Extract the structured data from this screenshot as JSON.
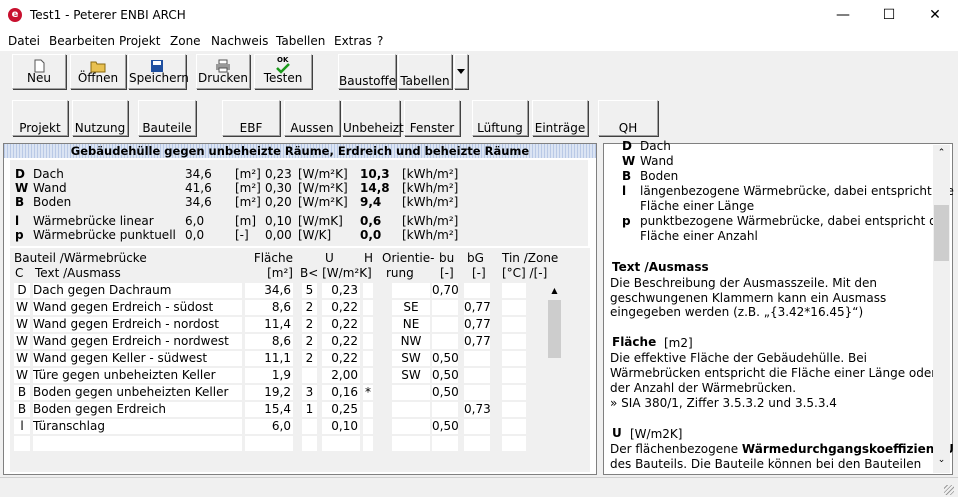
{
  "window": {
    "title": "Test1 - Peterer ENBI ARCH",
    "app_icon": "e"
  },
  "menu": [
    "Datei",
    "Bearbeiten",
    "Projekt",
    "Zone",
    "Nachweis",
    "Tabellen",
    "Extras",
    "?"
  ],
  "toolbar": [
    "Neu",
    "Öffnen",
    "Speichern",
    "Drucken",
    "Testen",
    "Baustoffe",
    "Tabellen"
  ],
  "testen_badge": "OK",
  "nav": [
    "Projekt",
    "Nutzung",
    "Bauteile",
    "EBF",
    "Aussen",
    "Unbeheizt",
    "Fenster",
    "Lüftung",
    "Einträge",
    "QH"
  ],
  "panel_title": "Gebäudehülle gegen unbeheizte Räume, Erdreich und beheizte Räume",
  "summary": [
    {
      "code": "D",
      "name": "Dach",
      "area": "34,6",
      "area_unit": "[m²]",
      "u": "0,23",
      "u_unit": "[W/m²K]",
      "q": "10,3",
      "q_unit": "[kWh/m²]"
    },
    {
      "code": "W",
      "name": "Wand",
      "area": "41,6",
      "area_unit": "[m²]",
      "u": "0,30",
      "u_unit": "[W/m²K]",
      "q": "14,8",
      "q_unit": "[kWh/m²]"
    },
    {
      "code": "B",
      "name": "Boden",
      "area": "34,6",
      "area_unit": "[m²]",
      "u": "0,20",
      "u_unit": "[W/m²K]",
      "q": "9,4",
      "q_unit": "[kWh/m²]"
    },
    {
      "code": "l",
      "name": "Wärmebrücke linear",
      "area": "6,0",
      "area_unit": "[m]",
      "u": "0,10",
      "u_unit": "[W/mK]",
      "q": "0,6",
      "q_unit": "[kWh/m²]"
    },
    {
      "code": "p",
      "name": "Wärmebrücke punktuell",
      "area": "0,0",
      "area_unit": "[-]",
      "u": "0,00",
      "u_unit": "[W/K]",
      "q": "0,0",
      "q_unit": "[kWh/m²]"
    }
  ],
  "headers": {
    "bauteil": "Bauteil /Wärmebrücke",
    "c": "C",
    "text": "Text /Ausmass",
    "flaeche": "Fläche",
    "flaeche_unit": "[m²]",
    "u": "U",
    "b_u": "B< [W/m²K]",
    "h": "H",
    "orient1": "Orientie-",
    "orient2": "rung",
    "bu": "bu",
    "bu_unit": "[-]",
    "bg": "bG",
    "bg_unit": "[-]",
    "tin": "Tin /Zone",
    "tin_unit": "[°C] /[-]"
  },
  "rows": [
    {
      "c": "D",
      "text": "Dach gegen Dachraum",
      "area": "34,6",
      "b": "5",
      "u": "0,23",
      "h": "",
      "or": "",
      "bu": "0,70",
      "bg": ""
    },
    {
      "c": "W",
      "text": "Wand gegen Erdreich - südost",
      "area": "8,6",
      "b": "2",
      "u": "0,22",
      "h": "",
      "or": "SE",
      "bu": "",
      "bg": "0,77"
    },
    {
      "c": "W",
      "text": "Wand gegen Erdreich - nordost",
      "area": "11,4",
      "b": "2",
      "u": "0,22",
      "h": "",
      "or": "NE",
      "bu": "",
      "bg": "0,77"
    },
    {
      "c": "W",
      "text": "Wand gegen Erdreich - nordwest",
      "area": "8,6",
      "b": "2",
      "u": "0,22",
      "h": "",
      "or": "NW",
      "bu": "",
      "bg": "0,77"
    },
    {
      "c": "W",
      "text": "Wand gegen Keller - südwest",
      "area": "11,1",
      "b": "2",
      "u": "0,22",
      "h": "",
      "or": "SW",
      "bu": "0,50",
      "bg": ""
    },
    {
      "c": "W",
      "text": "Türe gegen unbeheizten Keller",
      "area": "1,9",
      "b": "",
      "u": "2,00",
      "h": "",
      "or": "SW",
      "bu": "0,50",
      "bg": ""
    },
    {
      "c": "B",
      "text": "Boden gegen unbeheizten Keller",
      "area": "19,2",
      "b": "3",
      "u": "0,16",
      "h": "*",
      "or": "",
      "bu": "0,50",
      "bg": ""
    },
    {
      "c": "B",
      "text": "Boden gegen Erdreich",
      "area": "15,4",
      "b": "1",
      "u": "0,25",
      "h": "",
      "or": "",
      "bu": "",
      "bg": "0,73"
    },
    {
      "c": "l",
      "text": "Türanschlag",
      "area": "6,0",
      "b": "",
      "u": "0,10",
      "h": "",
      "or": "",
      "bu": "0,50",
      "bg": ""
    },
    {
      "c": "",
      "text": "",
      "area": "",
      "b": "",
      "u": "",
      "h": "",
      "or": "",
      "bu": "",
      "bg": ""
    }
  ],
  "help": {
    "legend": [
      {
        "k": "D",
        "v": "Dach"
      },
      {
        "k": "W",
        "v": "Wand"
      },
      {
        "k": "B",
        "v": "Boden"
      },
      {
        "k": "l",
        "v": "längenbezogene Wärmebrücke, dabei entspricht die",
        "v2": "Fläche einer Länge"
      },
      {
        "k": "p",
        "v": "punktbezogene Wärmebrücke, dabei entspricht die",
        "v2": "Fläche einer Anzahl"
      }
    ],
    "s1_title": "Text /Ausmass",
    "s1_lines": [
      "Die Beschreibung der Ausmasszeile. Mit den",
      "geschwungenen Klammern kann ein Ausmass",
      "eingegeben werden (z.B. „{3.42*16.45}“)"
    ],
    "s2_title": "Fläche",
    "s2_unit": "[m2]",
    "s2_lines": [
      "Die effektive Fläche der Gebäudehülle. Bei",
      "Wärmebrücken entspricht die Fläche einer Länge oder",
      "der Anzahl der Wärmebrücken.",
      "» SIA 380/1, Ziffer 3.5.3.2 und 3.5.3.4"
    ],
    "s3_title": "U",
    "s3_unit": "[W/m2K]",
    "s3_l1a": "Der flächenbezogene ",
    "s3_l1b": "Wärmedurchgangskoeffizient U",
    "s3_l2": "des Bauteils. Die Bauteile können bei den Bauteilen"
  }
}
